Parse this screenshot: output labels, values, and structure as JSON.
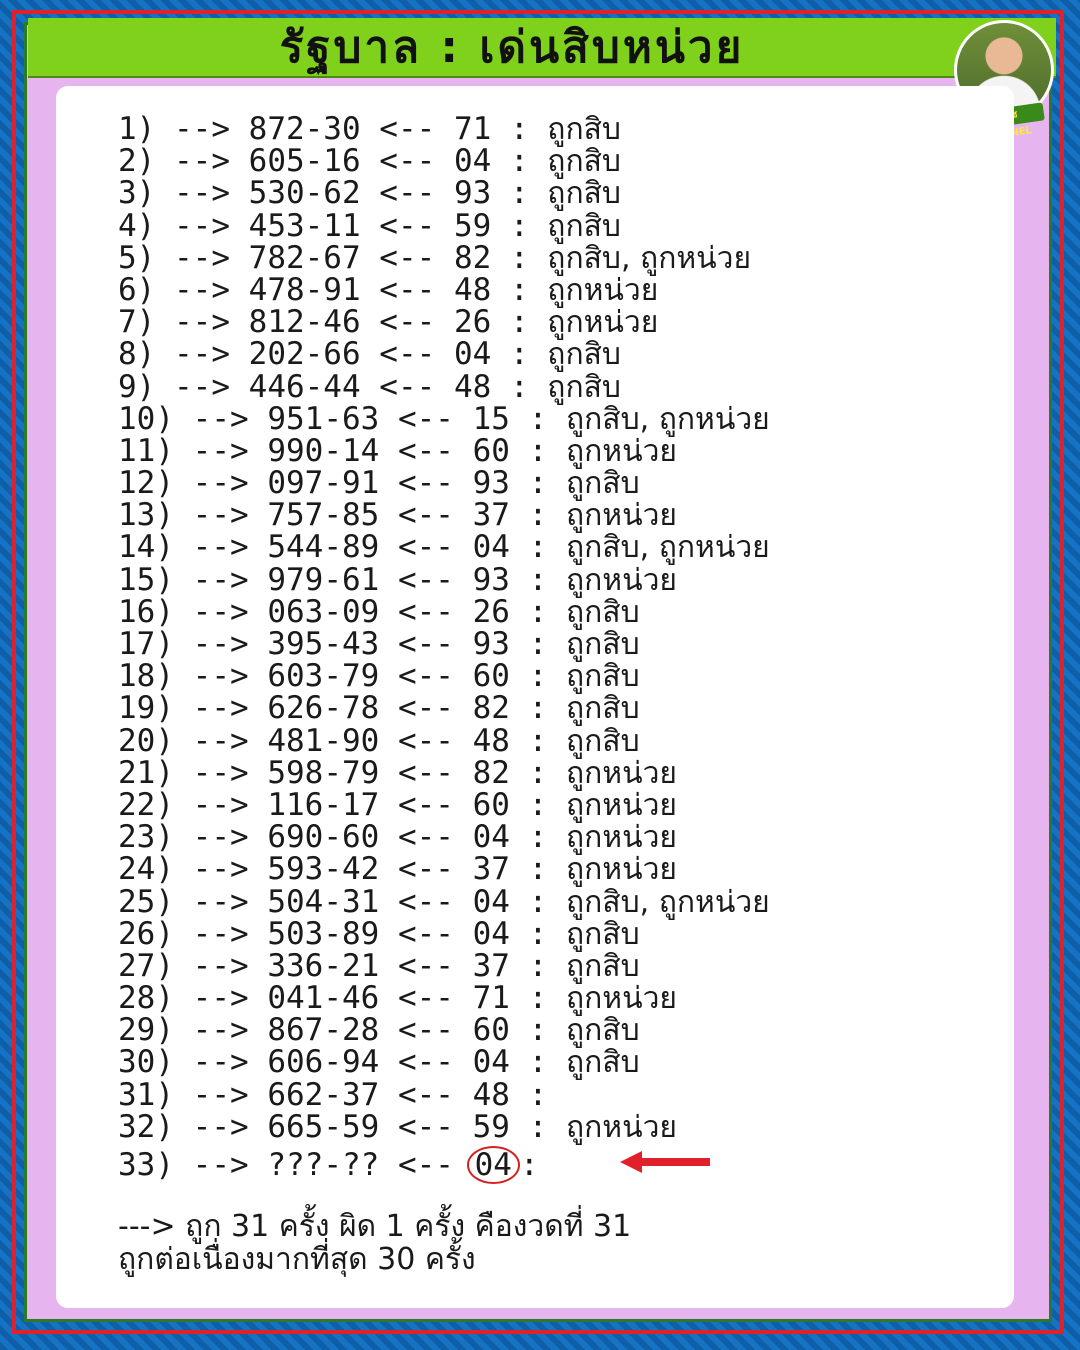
{
  "title": "รัฐบาล : เด่นสิบหน่วย",
  "badge": "ฤดูเดช CHANNEL",
  "rows": [
    {
      "n": "1)",
      "num": "872-30",
      "key": "71",
      "result": "ถูกสิบ"
    },
    {
      "n": "2)",
      "num": "605-16",
      "key": "04",
      "result": "ถูกสิบ"
    },
    {
      "n": "3)",
      "num": "530-62",
      "key": "93",
      "result": "ถูกสิบ"
    },
    {
      "n": "4)",
      "num": "453-11",
      "key": "59",
      "result": "ถูกสิบ"
    },
    {
      "n": "5)",
      "num": "782-67",
      "key": "82",
      "result": "ถูกสิบ, ถูกหน่วย"
    },
    {
      "n": "6)",
      "num": "478-91",
      "key": "48",
      "result": "ถูกหน่วย"
    },
    {
      "n": "7)",
      "num": "812-46",
      "key": "26",
      "result": "ถูกหน่วย"
    },
    {
      "n": "8)",
      "num": "202-66",
      "key": "04",
      "result": "ถูกสิบ"
    },
    {
      "n": "9)",
      "num": "446-44",
      "key": "48",
      "result": "ถูกสิบ"
    },
    {
      "n": "10)",
      "num": "951-63",
      "key": "15",
      "result": "ถูกสิบ, ถูกหน่วย"
    },
    {
      "n": "11)",
      "num": "990-14",
      "key": "60",
      "result": "ถูกหน่วย"
    },
    {
      "n": "12)",
      "num": "097-91",
      "key": "93",
      "result": "ถูกสิบ"
    },
    {
      "n": "13)",
      "num": "757-85",
      "key": "37",
      "result": "ถูกหน่วย"
    },
    {
      "n": "14)",
      "num": "544-89",
      "key": "04",
      "result": "ถูกสิบ, ถูกหน่วย"
    },
    {
      "n": "15)",
      "num": "979-61",
      "key": "93",
      "result": "ถูกหน่วย"
    },
    {
      "n": "16)",
      "num": "063-09",
      "key": "26",
      "result": "ถูกสิบ"
    },
    {
      "n": "17)",
      "num": "395-43",
      "key": "93",
      "result": "ถูกสิบ"
    },
    {
      "n": "18)",
      "num": "603-79",
      "key": "60",
      "result": "ถูกสิบ"
    },
    {
      "n": "19)",
      "num": "626-78",
      "key": "82",
      "result": "ถูกสิบ"
    },
    {
      "n": "20)",
      "num": "481-90",
      "key": "48",
      "result": "ถูกสิบ"
    },
    {
      "n": "21)",
      "num": "598-79",
      "key": "82",
      "result": "ถูกหน่วย"
    },
    {
      "n": "22)",
      "num": "116-17",
      "key": "60",
      "result": "ถูกหน่วย"
    },
    {
      "n": "23)",
      "num": "690-60",
      "key": "04",
      "result": "ถูกหน่วย"
    },
    {
      "n": "24)",
      "num": "593-42",
      "key": "37",
      "result": "ถูกหน่วย"
    },
    {
      "n": "25)",
      "num": "504-31",
      "key": "04",
      "result": "ถูกสิบ, ถูกหน่วย"
    },
    {
      "n": "26)",
      "num": "503-89",
      "key": "04",
      "result": "ถูกสิบ"
    },
    {
      "n": "27)",
      "num": "336-21",
      "key": "37",
      "result": "ถูกสิบ"
    },
    {
      "n": "28)",
      "num": "041-46",
      "key": "71",
      "result": "ถูกหน่วย"
    },
    {
      "n": "29)",
      "num": "867-28",
      "key": "60",
      "result": "ถูกสิบ"
    },
    {
      "n": "30)",
      "num": "606-94",
      "key": "04",
      "result": "ถูกสิบ"
    },
    {
      "n": "31)",
      "num": "662-37",
      "key": "48",
      "result": ""
    },
    {
      "n": "32)",
      "num": "665-59",
      "key": "59",
      "result": "ถูกหน่วย"
    }
  ],
  "last": {
    "n": "33)",
    "num": "???-??",
    "key": "04"
  },
  "summary": {
    "line1": "---> ถูก 31 ครั้ง ผิด 1 ครั้ง คืองวดที่ 31",
    "line2": "ถูกต่อเนื่องมากที่สุด 30 ครั้ง"
  },
  "colors": {
    "header": "#7fd11c",
    "frame": "#e0202a",
    "panel_bg": "#e6b5ef",
    "arrow": "#e0202a"
  }
}
